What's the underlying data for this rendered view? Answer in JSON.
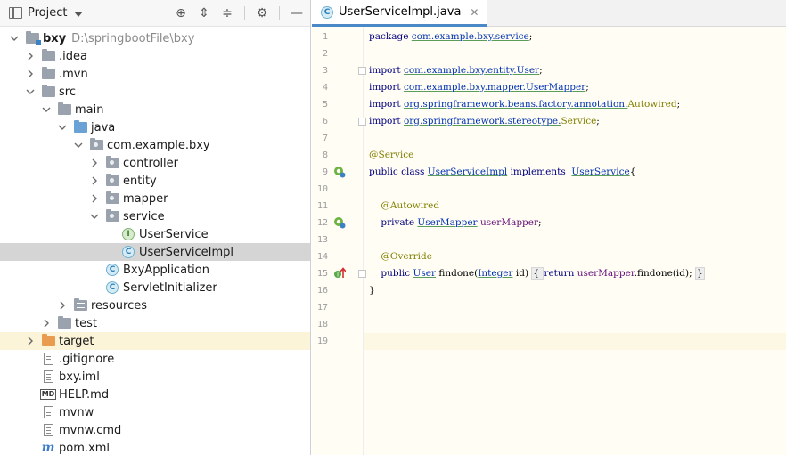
{
  "project_panel": {
    "title": "Project",
    "toolbar": [
      {
        "name": "locate-icon",
        "glyph": "⊕"
      },
      {
        "name": "expand-all-icon",
        "glyph": "⇕"
      },
      {
        "name": "collapse-all-icon",
        "glyph": "≑"
      },
      {
        "name": "settings-icon",
        "glyph": "⚙"
      },
      {
        "name": "hide-icon",
        "glyph": "—"
      }
    ],
    "tree": [
      {
        "label": "bxy",
        "path_hint": "D:\\springbootFile\\bxy",
        "depth": 0,
        "arrow": "down",
        "icon": "folder-module",
        "bold": true
      },
      {
        "label": ".idea",
        "depth": 1,
        "arrow": "right",
        "icon": "folder"
      },
      {
        "label": ".mvn",
        "depth": 1,
        "arrow": "right",
        "icon": "folder"
      },
      {
        "label": "src",
        "depth": 1,
        "arrow": "down",
        "icon": "folder"
      },
      {
        "label": "main",
        "depth": 2,
        "arrow": "down",
        "icon": "folder"
      },
      {
        "label": "java",
        "depth": 3,
        "arrow": "down",
        "icon": "folder-blue"
      },
      {
        "label": "com.example.bxy",
        "depth": 4,
        "arrow": "down",
        "icon": "package"
      },
      {
        "label": "controller",
        "depth": 5,
        "arrow": "right",
        "icon": "package"
      },
      {
        "label": "entity",
        "depth": 5,
        "arrow": "right",
        "icon": "package"
      },
      {
        "label": "mapper",
        "depth": 5,
        "arrow": "right",
        "icon": "package"
      },
      {
        "label": "service",
        "depth": 5,
        "arrow": "down",
        "icon": "package"
      },
      {
        "label": "UserService",
        "depth": 6,
        "arrow": "none",
        "icon": "interface"
      },
      {
        "label": "UserServiceImpl",
        "depth": 6,
        "arrow": "none",
        "icon": "class",
        "selected": true
      },
      {
        "label": "BxyApplication",
        "depth": 5,
        "arrow": "none",
        "icon": "class-run"
      },
      {
        "label": "ServletInitializer",
        "depth": 5,
        "arrow": "none",
        "icon": "class"
      },
      {
        "label": "resources",
        "depth": 3,
        "arrow": "right",
        "icon": "folder-res"
      },
      {
        "label": "test",
        "depth": 2,
        "arrow": "right",
        "icon": "folder"
      },
      {
        "label": "target",
        "depth": 1,
        "arrow": "right",
        "icon": "folder-orange",
        "excluded": true
      },
      {
        "label": ".gitignore",
        "depth": 1,
        "arrow": "none",
        "icon": "file"
      },
      {
        "label": "bxy.iml",
        "depth": 1,
        "arrow": "none",
        "icon": "file"
      },
      {
        "label": "HELP.md",
        "depth": 1,
        "arrow": "none",
        "icon": "md"
      },
      {
        "label": "mvnw",
        "depth": 1,
        "arrow": "none",
        "icon": "file"
      },
      {
        "label": "mvnw.cmd",
        "depth": 1,
        "arrow": "none",
        "icon": "file"
      },
      {
        "label": "pom.xml",
        "depth": 1,
        "arrow": "none",
        "icon": "pom"
      }
    ]
  },
  "editor": {
    "tab_label": "UserServiceImpl.java",
    "tab_close": "✕",
    "current_line": 19,
    "lines": [
      {
        "n": "1",
        "tokens": [
          [
            "kw",
            "package "
          ],
          [
            "pkg",
            "com.example.bxy.service"
          ],
          [
            "plain",
            ";"
          ]
        ]
      },
      {
        "n": "2",
        "tokens": []
      },
      {
        "n": "3",
        "tokens": [
          [
            "kw",
            "import "
          ],
          [
            "pkg",
            "com.example.bxy.entity.User"
          ],
          [
            "plain",
            ";"
          ]
        ],
        "fold": true
      },
      {
        "n": "4",
        "tokens": [
          [
            "kw",
            "import "
          ],
          [
            "pkg",
            "com.example.bxy.mapper."
          ],
          [
            "cls",
            "UserMapper"
          ],
          [
            "plain",
            ";"
          ]
        ]
      },
      {
        "n": "5",
        "tokens": [
          [
            "kw",
            "import "
          ],
          [
            "pkg",
            "org.springframework.beans.factory.annotation."
          ],
          [
            "ann",
            "Autowired"
          ],
          [
            "plain",
            ";"
          ]
        ]
      },
      {
        "n": "6",
        "tokens": [
          [
            "kw",
            "import "
          ],
          [
            "pkg",
            "org.springframework.stereotype."
          ],
          [
            "ann",
            "Service"
          ],
          [
            "plain",
            ";"
          ]
        ],
        "fold": true
      },
      {
        "n": "7",
        "tokens": []
      },
      {
        "n": "8",
        "tokens": [
          [
            "ann",
            "@Service"
          ]
        ]
      },
      {
        "n": "9",
        "tokens": [
          [
            "kw",
            "public class "
          ],
          [
            "cls",
            "UserServiceImpl"
          ],
          [
            "kw",
            " implements  "
          ],
          [
            "cls",
            "UserService"
          ],
          [
            "plain",
            "{"
          ]
        ],
        "mark": "bean"
      },
      {
        "n": "10",
        "tokens": []
      },
      {
        "n": "11",
        "tokens": [
          [
            "plain",
            "    "
          ],
          [
            "ann",
            "@Autowired"
          ]
        ]
      },
      {
        "n": "12",
        "tokens": [
          [
            "plain",
            "    "
          ],
          [
            "kw",
            "private "
          ],
          [
            "cls",
            "UserMapper"
          ],
          [
            "plain",
            " "
          ],
          [
            "field",
            "userMapper"
          ],
          [
            "plain",
            ";"
          ]
        ],
        "mark": "bean"
      },
      {
        "n": "13",
        "tokens": []
      },
      {
        "n": "14",
        "tokens": [
          [
            "plain",
            "    "
          ],
          [
            "ann",
            "@Override"
          ]
        ]
      },
      {
        "n": "15",
        "tokens": [
          [
            "plain",
            "    "
          ],
          [
            "kw",
            "public "
          ],
          [
            "cls",
            "User"
          ],
          [
            "plain",
            " "
          ],
          [
            "plain",
            "findone"
          ],
          [
            "plain",
            "("
          ],
          [
            "cls",
            "Integer"
          ],
          [
            "plain",
            " id) "
          ],
          [
            "hl",
            "{ "
          ],
          [
            "kw",
            "return "
          ],
          [
            "field",
            "userMapper"
          ],
          [
            "plain",
            ".findone(id); "
          ],
          [
            "hl",
            "}"
          ]
        ],
        "mark": "override",
        "fold": true
      },
      {
        "n": "16",
        "tokens": [
          [
            "plain",
            "}"
          ]
        ]
      },
      {
        "n": "17",
        "tokens": []
      },
      {
        "n": "18",
        "tokens": []
      },
      {
        "n": "19",
        "tokens": []
      }
    ]
  },
  "colors": {
    "keyword": "#000080",
    "annotation": "#808000",
    "link": "#0033b3",
    "field": "#660e7a",
    "selection": "#d5d5d5",
    "editor_bg": "#fffdf4",
    "tab_underline": "#4a88c7"
  }
}
